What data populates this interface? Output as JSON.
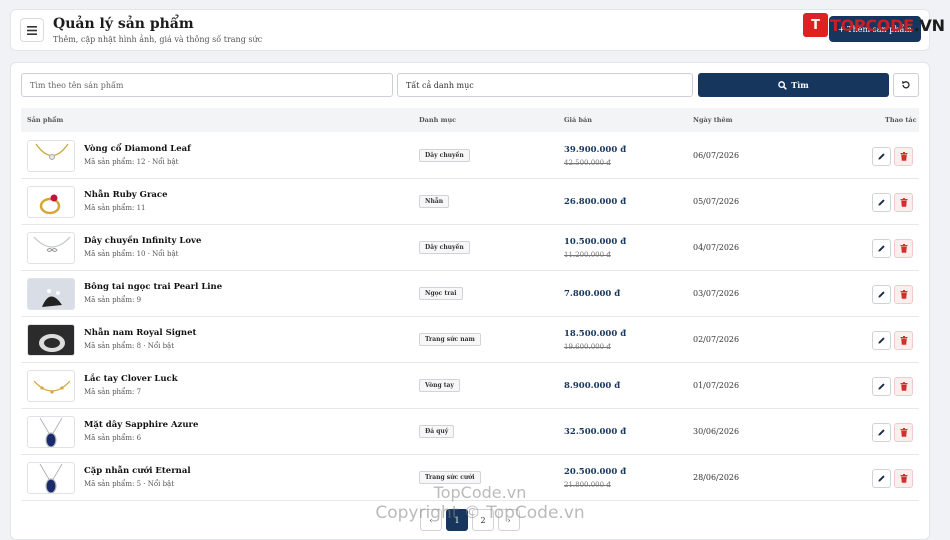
{
  "header": {
    "menu_icon": "menu-icon",
    "title": "Quản lý sản phẩm",
    "subtitle": "Thêm, cập nhật hình ảnh, giá và thông số trang sức",
    "add_button_label": "+ Thêm sản phẩm"
  },
  "logo": {
    "mark": "T",
    "text_red": "TOPCODE",
    "text_dark": ".VN"
  },
  "filters": {
    "search_placeholder": "Tìm theo tên sản phẩm",
    "category_value": "Tất cả danh mục",
    "search_button": "Tìm",
    "search_icon": "search-icon",
    "reset_icon": "refresh-icon"
  },
  "table": {
    "columns": [
      "Sản phẩm",
      "Danh mục",
      "Giá bán",
      "Ngày thêm",
      "Thao tác"
    ],
    "rows": [
      {
        "name": "Vòng cổ Diamond Leaf",
        "meta": "Mã sản phẩm: 12 · Nổi bật",
        "category": "Dây chuyền",
        "price": "39.900.000 đ",
        "old_price": "42.500.000 đ",
        "date": "06/07/2026",
        "thumb": "necklace-gold"
      },
      {
        "name": "Nhẫn Ruby Grace",
        "meta": "Mã sản phẩm: 11",
        "category": "Nhẫn",
        "price": "26.800.000 đ",
        "old_price": "",
        "date": "05/07/2026",
        "thumb": "ring-ruby"
      },
      {
        "name": "Dây chuyền Infinity Love",
        "meta": "Mã sản phẩm: 10 · Nổi bật",
        "category": "Dây chuyền",
        "price": "10.500.000 đ",
        "old_price": "11.200.000 đ",
        "date": "04/07/2026",
        "thumb": "necklace-silver"
      },
      {
        "name": "Bông tai ngọc trai Pearl Line",
        "meta": "Mã sản phẩm: 9",
        "category": "Ngọc trai",
        "price": "7.800.000 đ",
        "old_price": "",
        "date": "03/07/2026",
        "thumb": "earrings-pearl"
      },
      {
        "name": "Nhẫn nam Royal Signet",
        "meta": "Mã sản phẩm: 8 · Nổi bật",
        "category": "Trang sức nam",
        "price": "18.500.000 đ",
        "old_price": "19.600.000 đ",
        "date": "02/07/2026",
        "thumb": "ring-signet"
      },
      {
        "name": "Lắc tay Clover Luck",
        "meta": "Mã sản phẩm: 7",
        "category": "Vòng tay",
        "price": "8.900.000 đ",
        "old_price": "",
        "date": "01/07/2026",
        "thumb": "bracelet-gold"
      },
      {
        "name": "Mặt dây Sapphire Azure",
        "meta": "Mã sản phẩm: 6",
        "category": "Đá quý",
        "price": "32.500.000 đ",
        "old_price": "",
        "date": "30/06/2026",
        "thumb": "pendant-sapphire"
      },
      {
        "name": "Cặp nhẫn cưới Eternal",
        "meta": "Mã sản phẩm: 5 · Nổi bật",
        "category": "Trang sức cưới",
        "price": "20.500.000 đ",
        "old_price": "21.800.000 đ",
        "date": "28/06/2026",
        "thumb": "pendant-sapphire"
      }
    ],
    "edit_icon": "pencil-icon",
    "delete_icon": "trash-icon"
  },
  "pagination": {
    "prev": "‹",
    "current": "1",
    "next_page": "2",
    "next": "›"
  },
  "watermark": {
    "line1": "TopCode.vn",
    "line2": "Copyright © TopCode.vn"
  },
  "colors": {
    "primary": "#17365d",
    "danger": "#d32f2f",
    "logo_red": "#c81f25"
  }
}
